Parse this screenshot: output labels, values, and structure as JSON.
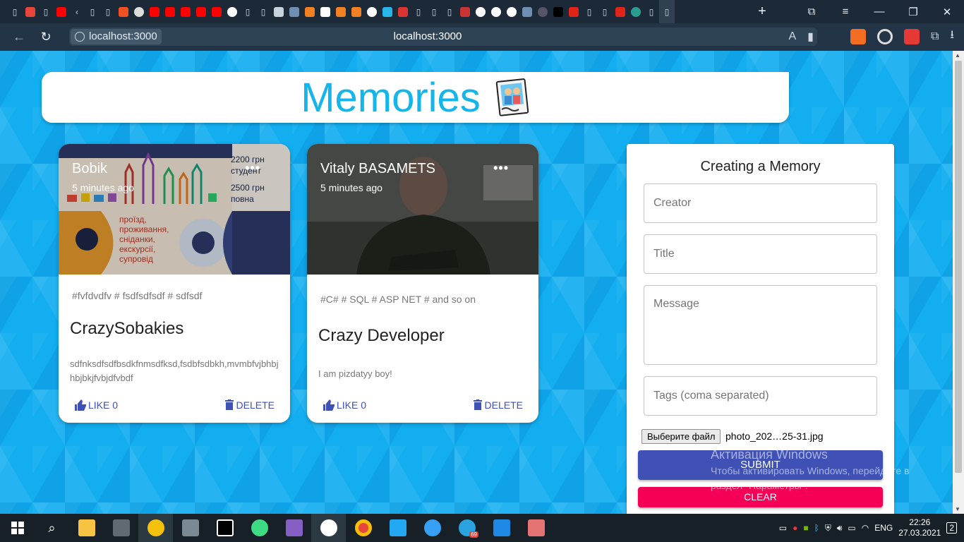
{
  "browser": {
    "url_chip": "localhost:3000",
    "url_center": "localhost:3000"
  },
  "app": {
    "title": "Memories"
  },
  "posts": [
    {
      "creator": "Bobik",
      "time": "5 minutes ago",
      "tags": "#fvfdvdfv # fsdfsdfsdf # sdfsdf",
      "title": "CrazySobakies",
      "message": "sdfnksdfsdfbsdkfnmsdfksd,fsdbfsdbkh,mvmbfvjbhbjhbjbkjfvbjdfvbdf",
      "like_label": "LIKE 0",
      "delete_label": "DELETE",
      "poster": {
        "price1": "2200 грн",
        "price1_sub": "студент",
        "price2": "2500 грн",
        "price2_sub": "повна",
        "lines": [
          "проїзд,",
          "проживання,",
          "сніданки,",
          "екскурсії,",
          "супровід"
        ]
      }
    },
    {
      "creator": "Vitaly BASAMETS",
      "time": "5 minutes ago",
      "tags": "#C# # SQL # ASP NET # and so on",
      "title": "Crazy Developer",
      "message": "I am pizdatyy boy!",
      "like_label": "LIKE 0",
      "delete_label": "DELETE"
    }
  ],
  "form": {
    "title": "Creating a Memory",
    "creator_placeholder": "Creator",
    "title_placeholder": "Title",
    "message_placeholder": "Message",
    "tags_placeholder": "Tags (coma separated)",
    "file_button": "Выберите файл",
    "file_name": "photo_202…25-31.jpg",
    "submit_label": "SUBMIT",
    "clear_label": "CLEAR"
  },
  "watermark": {
    "line1": "Активация Windows",
    "line2": "Чтобы активировать Windows, перейдите в раздел \"Параметры\"."
  },
  "taskbar": {
    "lang": "ENG",
    "time": "22:26",
    "date": "27.03.2021",
    "notifications": "2",
    "telegram_badge": "69"
  },
  "colors": {
    "accent": "#3f51b5",
    "secondary": "#f50057",
    "title": "#13b5ea",
    "background": "#12aef0"
  }
}
